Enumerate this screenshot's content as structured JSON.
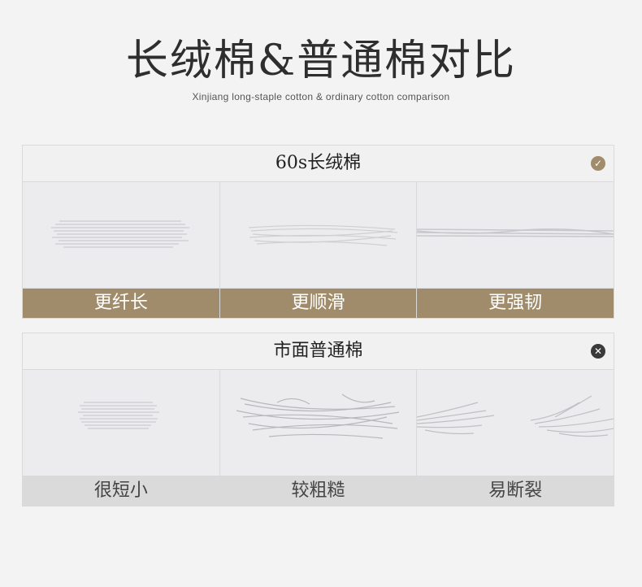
{
  "header": {
    "title": "长绒棉&普通棉对比",
    "subtitle": "Xinjiang long-staple cotton & ordinary cotton comparison"
  },
  "colors": {
    "accent": "#a08c6a",
    "bad_badge": "#3a3a3a",
    "good_badge": "#a08c6a"
  },
  "panels": [
    {
      "title": "60s长绒棉",
      "status_icon": "check-circle-icon",
      "features": [
        {
          "label": "更纤长",
          "image": "long-fiber-image"
        },
        {
          "label": "更顺滑",
          "image": "smooth-fiber-image"
        },
        {
          "label": "更强韧",
          "image": "strong-fiber-image"
        }
      ]
    },
    {
      "title": "市面普通棉",
      "status_icon": "x-circle-icon",
      "features": [
        {
          "label": "很短小",
          "image": "short-fiber-image"
        },
        {
          "label": "较粗糙",
          "image": "rough-fiber-image"
        },
        {
          "label": "易断裂",
          "image": "broken-fiber-image"
        }
      ]
    }
  ]
}
